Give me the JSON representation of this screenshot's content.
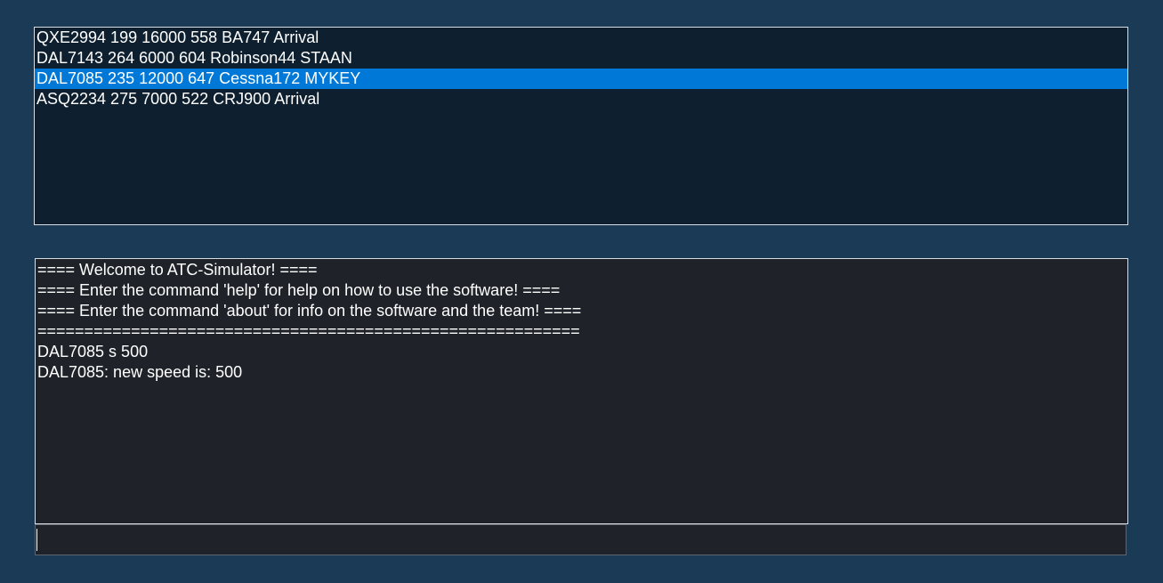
{
  "flights": [
    {
      "text": "QXE2994 199 16000 558 BA747 Arrival",
      "selected": false
    },
    {
      "text": "DAL7143 264 6000 604 Robinson44 STAAN",
      "selected": false
    },
    {
      "text": "DAL7085 235 12000 647 Cessna172 MYKEY",
      "selected": true
    },
    {
      "text": "ASQ2234 275 7000 522 CRJ900 Arrival",
      "selected": false
    }
  ],
  "console": {
    "lines": [
      "==== Welcome to ATC-Simulator! ====",
      "==== Enter the command 'help' for help on how to use the software! ====",
      "==== Enter the command 'about' for info on the software and the team! ====",
      "==========================================================",
      "DAL7085 s 500",
      "DAL7085: new speed is: 500"
    ]
  },
  "command_input": {
    "value": "",
    "placeholder": ""
  },
  "colors": {
    "background": "#1b3a55",
    "list_background": "#0e2030",
    "selection": "#0078d7",
    "console_background": "#1f2329",
    "text": "#ffffff"
  }
}
